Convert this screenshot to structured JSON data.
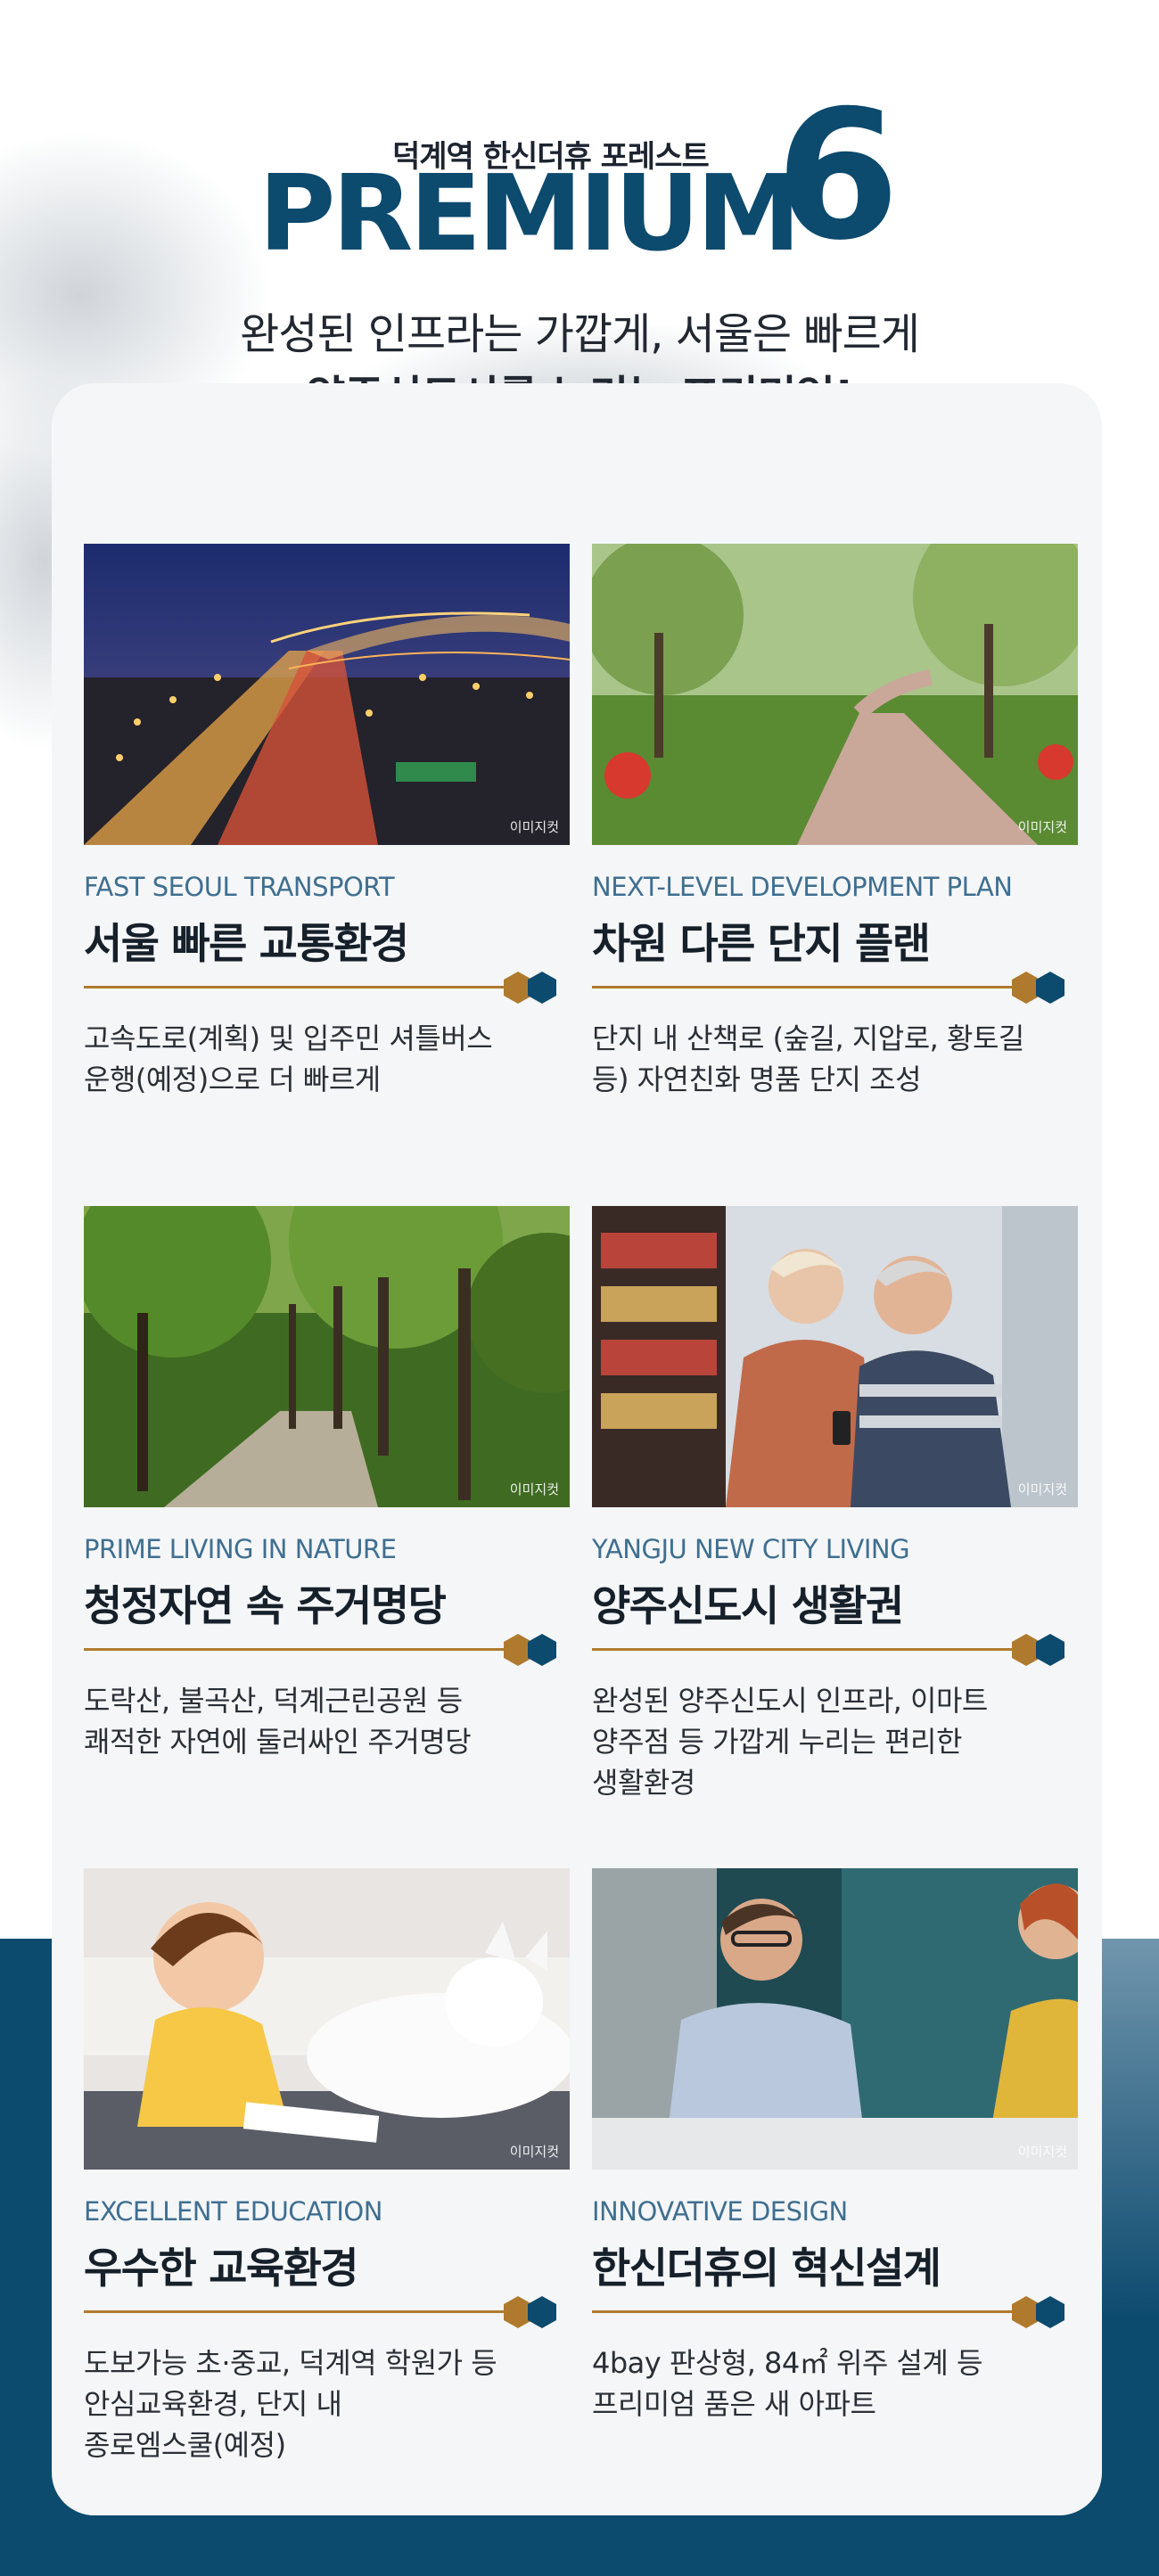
{
  "header": {
    "subtitle": "덕계역 한신더휴 포레스트",
    "premium": "PREMIUM",
    "number": "6",
    "tagline_line1": "완성된 인프라는 가깝게, 서울은 빠르게",
    "tagline_line2": "양주신도시를 누리는 프리미엄!"
  },
  "colors": {
    "navy": "#0c4a6e",
    "gold": "#b07a2e",
    "card_bg": "#f5f6f8"
  },
  "items": [
    {
      "watermark": "이미지컷",
      "en": "FAST SEOUL TRANSPORT",
      "ko": "서울 빠른 교통환경",
      "desc": [
        "고속도로(계획) 및 입주민 셔틀버스",
        "운행(예정)으로 더 빠르게"
      ]
    },
    {
      "watermark": "이미지컷",
      "en": "NEXT-LEVEL DEVELOPMENT PLAN",
      "ko": "차원 다른 단지 플랜",
      "desc": [
        "단지 내 산책로 (숲길, 지압로, 황토길",
        "등) 자연친화 명품 단지 조성"
      ]
    },
    {
      "watermark": "이미지컷",
      "en": "PRIME LIVING IN NATURE",
      "ko": "청정자연 속 주거명당",
      "desc": [
        "도락산, 불곡산, 덕계근린공원 등",
        "쾌적한 자연에 둘러싸인 주거명당"
      ]
    },
    {
      "watermark": "이미지컷",
      "en": "YANGJU NEW CITY LIVING",
      "ko": "양주신도시 생활권",
      "desc": [
        "완성된 양주신도시 인프라, 이마트",
        "양주점 등 가깝게 누리는 편리한",
        "생활환경"
      ]
    },
    {
      "watermark": "이미지컷",
      "en": "EXCELLENT EDUCATION",
      "ko": "우수한 교육환경",
      "desc": [
        "도보가능 초·중교, 덕계역 학원가 등",
        "안심교육환경, 단지 내",
        "종로엠스쿨(예정)"
      ]
    },
    {
      "watermark": "이미지컷",
      "en": "INNOVATIVE DESIGN",
      "ko": "한신더휴의 혁신설계",
      "desc": [
        "4bay 판상형, 84㎡ 위주 설계 등",
        "프리미엄 품은 새 아파트"
      ]
    }
  ]
}
